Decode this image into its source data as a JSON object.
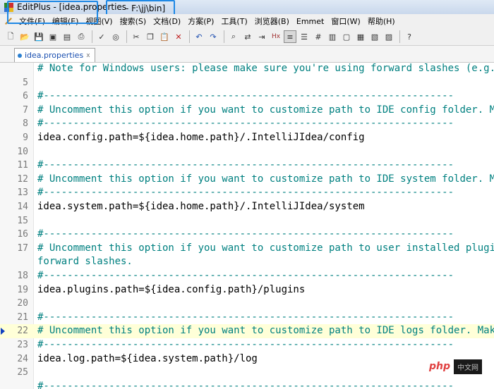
{
  "window": {
    "title": "EditPlus - [idea.properties",
    "path": " - F:\\jj\\bin]"
  },
  "menu": [
    "文件(F)",
    "编辑(E)",
    "视图(V)",
    "搜索(S)",
    "文档(D)",
    "方案(P)",
    "工具(T)",
    "浏览器(B)",
    "Emmet",
    "窗口(W)",
    "帮助(H)"
  ],
  "toolbar": {
    "icons": [
      "new-file-icon",
      "open-file-icon",
      "save-icon",
      "save-all-icon",
      "print-preview-icon",
      "print-icon",
      "spellcheck-icon",
      "browser-icon",
      "cut-icon",
      "copy-icon",
      "paste-icon",
      "delete-icon",
      "undo-icon",
      "redo-icon",
      "find-icon",
      "replace-icon",
      "goto-icon",
      "hex-icon",
      "word-wrap-icon",
      "ruler-icon",
      "line-number-icon",
      "column-icon",
      "fullscreen-icon",
      "output-icon",
      "directory-icon",
      "cliptext-icon",
      "help-icon"
    ],
    "labels": {
      "hex": "Hx"
    }
  },
  "tab": {
    "label": "idea.properties"
  },
  "editor": {
    "current_line": 21,
    "lines": [
      {
        "n": "",
        "text": "# Note for Windows users: please make sure you're using forward slashes (e.g.",
        "kind": "comment"
      },
      {
        "n": "5",
        "text": "",
        "kind": "text"
      },
      {
        "n": "6",
        "text": "#---------------------------------------------------------------------",
        "kind": "comment"
      },
      {
        "n": "7",
        "text": "# Uncomment this option if you want to customize path to IDE config folder. M",
        "kind": "comment"
      },
      {
        "n": "8",
        "text": "#---------------------------------------------------------------------",
        "kind": "comment"
      },
      {
        "n": "9",
        "text": "idea.config.path=${idea.home.path}/.IntelliJIdea/config",
        "kind": "text"
      },
      {
        "n": "10",
        "text": "",
        "kind": "text"
      },
      {
        "n": "11",
        "text": "#---------------------------------------------------------------------",
        "kind": "comment"
      },
      {
        "n": "12",
        "text": "# Uncomment this option if you want to customize path to IDE system folder. M",
        "kind": "comment"
      },
      {
        "n": "13",
        "text": "#---------------------------------------------------------------------",
        "kind": "comment"
      },
      {
        "n": "14",
        "text": "idea.system.path=${idea.home.path}/.IntelliJIdea/system",
        "kind": "text"
      },
      {
        "n": "15",
        "text": "",
        "kind": "text"
      },
      {
        "n": "16",
        "text": "#---------------------------------------------------------------------",
        "kind": "comment"
      },
      {
        "n": "17",
        "text": "# Uncomment this option if you want to customize path to user installed plugi",
        "kind": "comment"
      },
      {
        "n": "",
        "text": "forward slashes.",
        "kind": "comment"
      },
      {
        "n": "18",
        "text": "#---------------------------------------------------------------------",
        "kind": "comment"
      },
      {
        "n": "19",
        "text": "idea.plugins.path=${idea.config.path}/plugins",
        "kind": "text"
      },
      {
        "n": "20",
        "text": "",
        "kind": "text"
      },
      {
        "n": "21",
        "text": "#---------------------------------------------------------------------",
        "kind": "comment"
      },
      {
        "n": "22",
        "text": "# Uncomment this option if you want to customize path to IDE logs folder. Mak",
        "kind": "comment"
      },
      {
        "n": "23",
        "text": "#---------------------------------------------------------------------",
        "kind": "comment"
      },
      {
        "n": "24",
        "text": "idea.log.path=${idea.system.path}/log",
        "kind": "text"
      },
      {
        "n": "25",
        "text": "",
        "kind": "text"
      },
      {
        "n": "",
        "text": "#---------------------------------------------------------------------",
        "kind": "comment"
      }
    ]
  },
  "watermark": {
    "brand": "php",
    "suffix": "中文网"
  }
}
